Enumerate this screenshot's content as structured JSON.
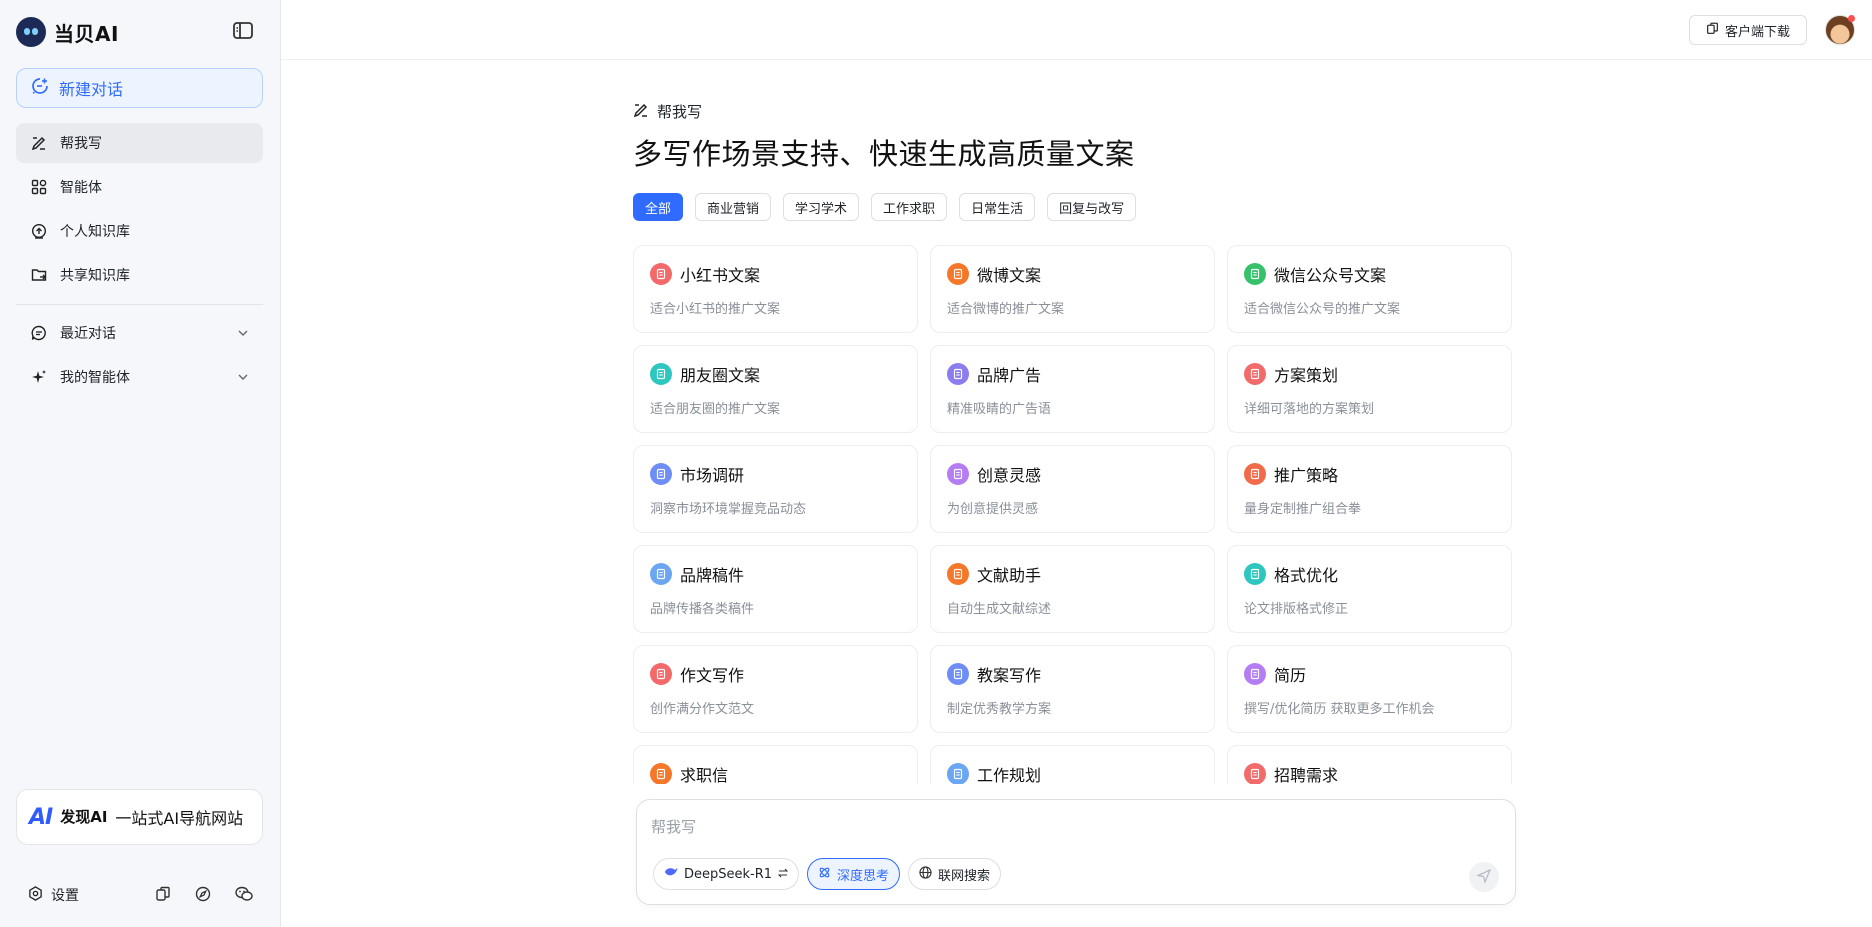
{
  "brand": {
    "name": "当贝AI",
    "icon": "robot-logo-icon"
  },
  "sidebar": {
    "new_chat": "新建对话",
    "items": [
      {
        "label": "帮我写",
        "icon": "pen-icon",
        "active": true
      },
      {
        "label": "智能体",
        "icon": "apps-icon"
      },
      {
        "label": "个人知识库",
        "icon": "upload-icon"
      },
      {
        "label": "共享知识库",
        "icon": "folder-share-icon"
      }
    ],
    "sections": [
      {
        "label": "最近对话",
        "icon": "chat-icon"
      },
      {
        "label": "我的智能体",
        "icon": "sparkle-icon"
      }
    ],
    "promo": {
      "logo": "AI",
      "brand": "发现AI",
      "text": "一站式AI导航网站"
    },
    "settings": "设置"
  },
  "header": {
    "download": "客户端下载"
  },
  "main": {
    "section_tag": "帮我写",
    "headline": "多写作场景支持、快速生成高质量文案",
    "filters": [
      "全部",
      "商业营销",
      "学习学术",
      "工作求职",
      "日常生活",
      "回复与改写"
    ],
    "active_filter": "全部",
    "cards": [
      {
        "title": "小红书文案",
        "desc": "适合小红书的推广文案",
        "color": "#f26a6a"
      },
      {
        "title": "微博文案",
        "desc": "适合微博的推广文案",
        "color": "#f5772a"
      },
      {
        "title": "微信公众号文案",
        "desc": "适合微信公众号的推广文案",
        "color": "#35c26a"
      },
      {
        "title": "朋友圈文案",
        "desc": "适合朋友圈的推广文案",
        "color": "#2dc7c0"
      },
      {
        "title": "品牌广告",
        "desc": "精准吸睛的广告语",
        "color": "#8b7cf0"
      },
      {
        "title": "方案策划",
        "desc": "详细可落地的方案策划",
        "color": "#f26a6a"
      },
      {
        "title": "市场调研",
        "desc": "洞察市场环境掌握竞品动态",
        "color": "#6f8ef5"
      },
      {
        "title": "创意灵感",
        "desc": "为创意提供灵感",
        "color": "#b47ef2"
      },
      {
        "title": "推广策略",
        "desc": "量身定制推广组合拳",
        "color": "#f26a4a"
      },
      {
        "title": "品牌稿件",
        "desc": "品牌传播各类稿件",
        "color": "#6aa6f2"
      },
      {
        "title": "文献助手",
        "desc": "自动生成文献综述",
        "color": "#f5772a"
      },
      {
        "title": "格式优化",
        "desc": "论文排版格式修正",
        "color": "#2dc7c0"
      },
      {
        "title": "作文写作",
        "desc": "创作满分作文范文",
        "color": "#f26a6a"
      },
      {
        "title": "教案写作",
        "desc": "制定优秀教学方案",
        "color": "#6f8ef5"
      },
      {
        "title": "简历",
        "desc": "撰写/优化简历 获取更多工作机会",
        "color": "#b47ef2"
      },
      {
        "title": "求职信",
        "desc": "",
        "color": "#f5772a"
      },
      {
        "title": "工作规划",
        "desc": "",
        "color": "#6aa6f2"
      },
      {
        "title": "招聘需求",
        "desc": "",
        "color": "#f26a6a"
      }
    ]
  },
  "composer": {
    "placeholder": "帮我写",
    "model": "DeepSeek-R1",
    "deep_think": "深度思考",
    "web_search": "联网搜索"
  }
}
